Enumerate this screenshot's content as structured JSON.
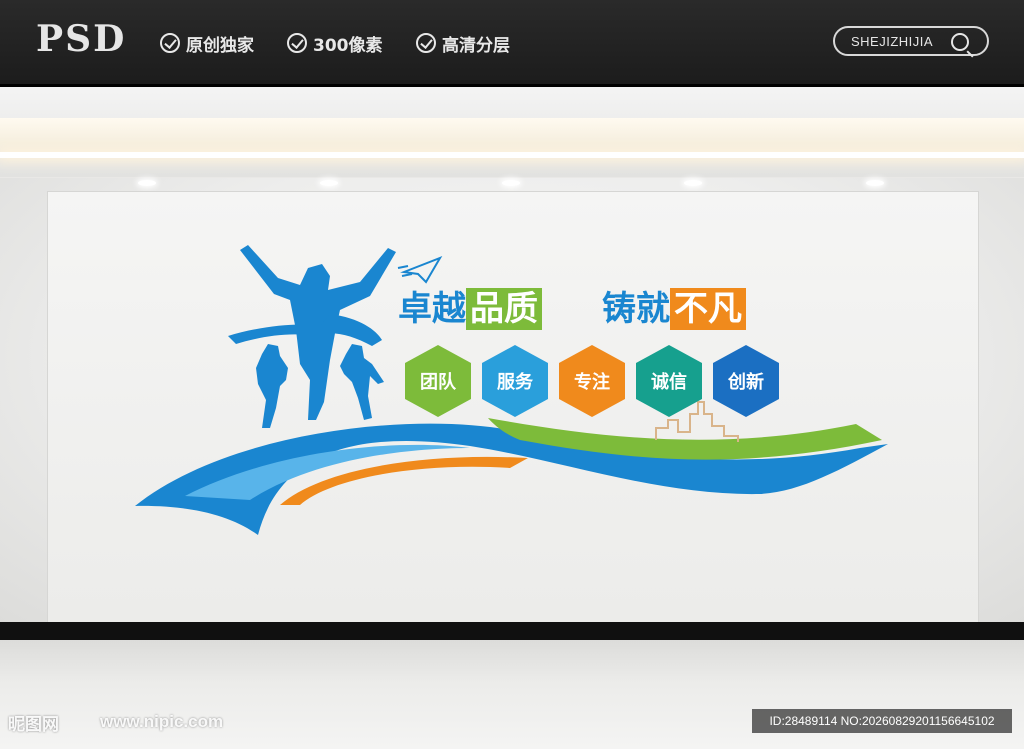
{
  "header": {
    "logo_text": "PSD",
    "features": [
      "原创独家",
      "300像素",
      "高清分层"
    ],
    "search_text": "SHEJIZHIJIA",
    "search_icon": "search-icon"
  },
  "wall": {
    "slogan_part1_plain": "卓越",
    "slogan_part1_box": "品质",
    "slogan_part2_plain": "铸就",
    "slogan_part2_box": "不凡",
    "values": [
      "团队",
      "服务",
      "专注",
      "诚信",
      "创新"
    ],
    "value_colors": [
      "#7dbb3a",
      "#2a9fdb",
      "#f08a1c",
      "#16a08e",
      "#1b6fc2"
    ],
    "accent_blue": "#1a86d0",
    "accent_green": "#7dbb3a",
    "accent_orange": "#f08a1c"
  },
  "watermark": {
    "site_name": "昵图网",
    "url": "www.nipic.com",
    "id_text": "ID:28489114 NO:20260829201156645102"
  }
}
